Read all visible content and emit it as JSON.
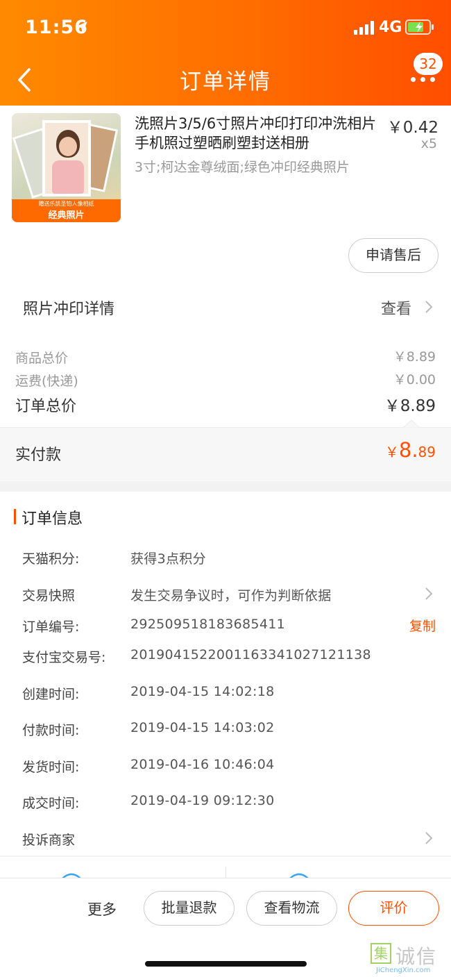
{
  "status_bar": {
    "time": "11:56",
    "network": "4G"
  },
  "nav": {
    "title": "订单详情",
    "badge": "32"
  },
  "product": {
    "title": "洗照片3/5/6寸照片冲印打印冲洗相片手机照过塑晒刷塑封送相册",
    "price": "￥0.42",
    "quantity": "x5",
    "spec": "3寸;柯达金尊绒面;绿色冲印经典照片",
    "image_banner": "经典照片",
    "image_caption": "赠送乐凯圣铂人像相纸"
  },
  "after_sales_label": "申请售后",
  "photo_details": {
    "label": "照片冲印详情",
    "action": "查看"
  },
  "price_summary": {
    "goods_total_label": "商品总价",
    "goods_total_value": "￥8.89",
    "shipping_label": "运费(快递)",
    "shipping_value": "￥0.00",
    "order_total_label": "订单总价",
    "order_total_value": "￥8.89",
    "paid_label": "实付款",
    "paid_currency": "￥",
    "paid_int": "8.",
    "paid_dec": "89"
  },
  "order_info": {
    "heading": "订单信息",
    "points_label": "天猫积分:",
    "points_value": "获得3点积分",
    "snapshot_label": "交易快照",
    "snapshot_value": "发生交易争议时，可作为判断依据",
    "order_no_label": "订单编号:",
    "order_no_value": "292509518183685411",
    "copy_label": "复制",
    "alipay_label": "支付宝交易号:",
    "alipay_value": "2019041522001163341027121138",
    "created_label": "创建时间:",
    "created_value": "2019-04-15 14:02:18",
    "paid_time_label": "付款时间:",
    "paid_time_value": "2019-04-15 14:03:02",
    "shipped_label": "发货时间:",
    "shipped_value": "2019-04-16 10:46:04",
    "completed_label": "成交时间:",
    "completed_value": "2019-04-19 09:12:30",
    "complain_label": "投诉商家"
  },
  "bottom": {
    "more": "更多",
    "refund": "批量退款",
    "logistics": "查看物流",
    "review": "评价"
  },
  "watermark": {
    "glyph": "集",
    "text": "诚信",
    "url": "JiChengXin.com"
  },
  "colors": {
    "accent": "#ff5000",
    "header_start": "#ff8a00",
    "header_end": "#ff4e00"
  }
}
